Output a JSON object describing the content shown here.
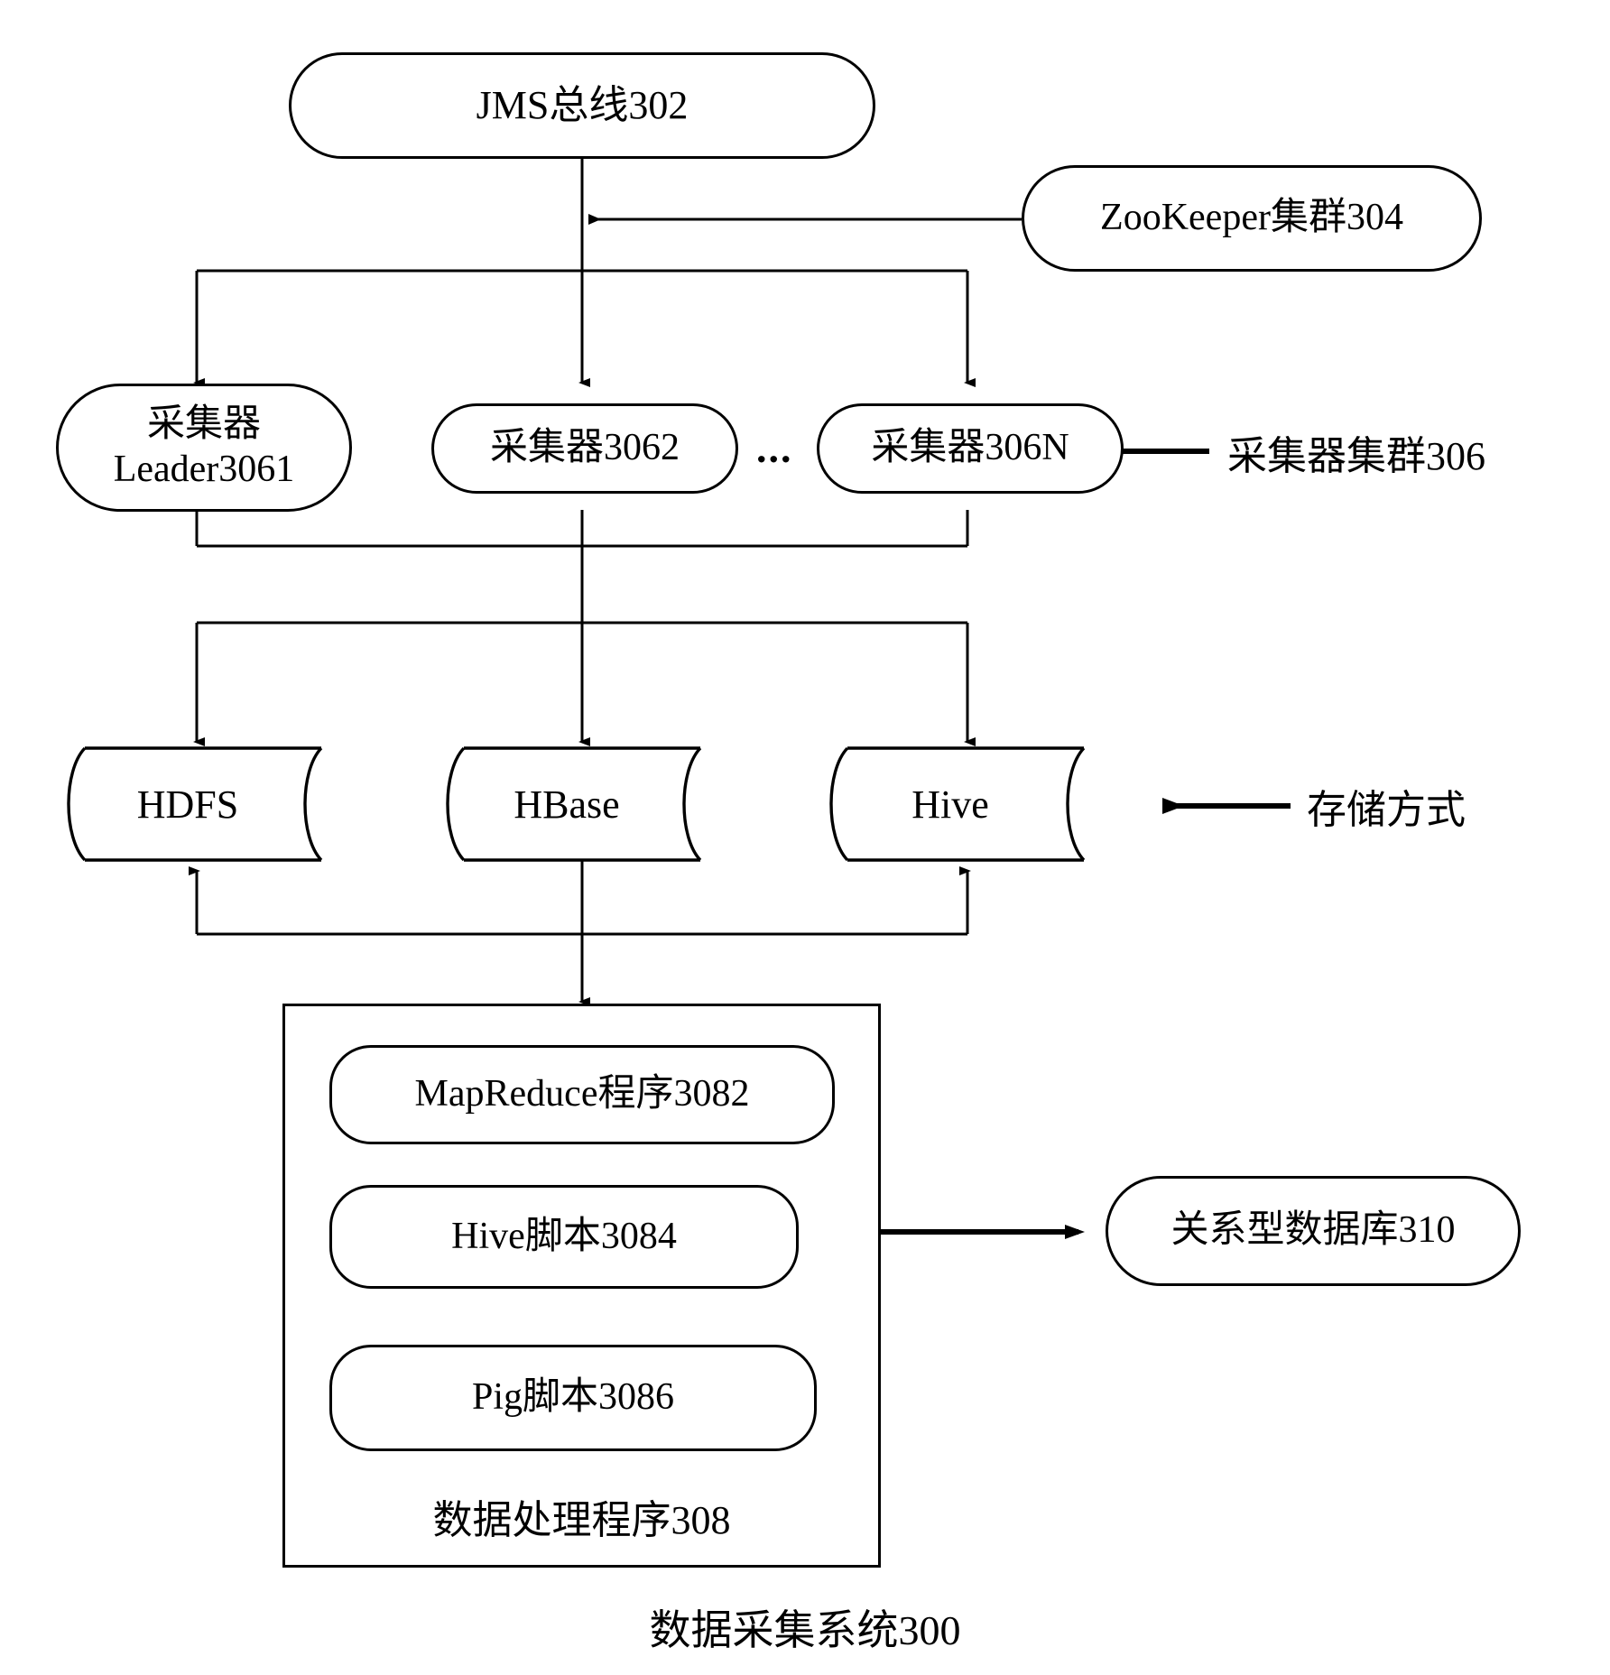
{
  "diagram": {
    "figure_caption": "数据采集系统300",
    "ellipsis": "...",
    "nodes": {
      "jms_bus": "JMS总线302",
      "zookeeper_cluster": "ZooKeeper集群304",
      "collector_leader_line1": "采集器",
      "collector_leader_line2": "Leader3061",
      "collector_2": "采集器3062",
      "collector_n": "采集器306N",
      "storage_hdfs": "HDFS",
      "storage_hbase": "HBase",
      "storage_hive": "Hive",
      "mapreduce_program": "MapReduce程序3082",
      "hive_script": "Hive脚本3084",
      "pig_script": "Pig脚本3086",
      "data_process_group": "数据处理程序308",
      "relational_database": "关系型数据库310"
    },
    "annotations": {
      "collector_cluster": "采集器集群306",
      "storage_mode": "存储方式"
    },
    "colors": {
      "stroke": "#000000",
      "background": "#ffffff",
      "text": "#000000"
    }
  }
}
